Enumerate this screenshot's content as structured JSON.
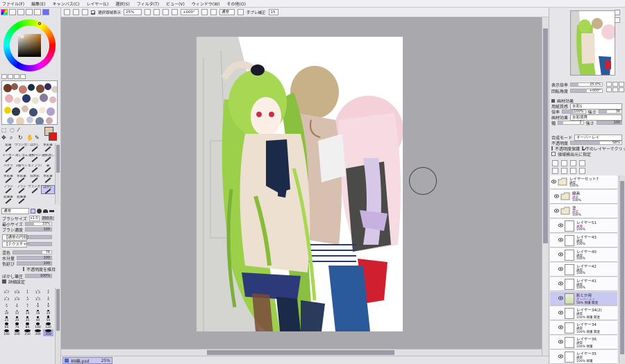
{
  "menu": [
    "ファイル(F)",
    "編集(E)",
    "キャンバス(C)",
    "レイヤー(L)",
    "選択(S)",
    "フィルタ(T)",
    "ビュー(V)",
    "ウィンドウ(W)",
    "その他(O)"
  ],
  "toolbar": {
    "selection_source_label": "選択領域表示",
    "zoom": "25%",
    "rotation": "+000°",
    "mode": "通常",
    "stabilizer_label": "手ブレ補正",
    "stabilizer_value": "15"
  },
  "tools": {
    "row1": [
      "鉛筆",
      "ウランガン",
      "ぼかし",
      "水彩筆"
    ],
    "row2": [
      "マーカー",
      "消しゴム",
      "選択ペン",
      "選択消し"
    ],
    "row3": [
      "バケツ",
      "2値ペン",
      "エアブラシ",
      "筆"
    ],
    "row4": [
      "水彩筆",
      "水彩筆",
      "旧水彩",
      "水彩筆"
    ],
    "row5": [
      "ブラシ",
      "ブラシ",
      "ウランガン",
      "ぼかし"
    ],
    "row6": [
      "鉛筆筆",
      "鉛筆筆"
    ]
  },
  "brush": {
    "mode": "通常",
    "size_label": "ブラシサイズ",
    "size_mult": "x1.0",
    "size_value": "350.0",
    "min_size_label": "最小サイズ",
    "min_size_value": "33%",
    "density_label": "ブラシ濃度",
    "density_value": "100",
    "shape_label": "【通常の円形】",
    "texture_label": "【テクスチャなし】",
    "blend_label": "混色",
    "blend_value": "76",
    "water_label": "水分量",
    "water_value": "100",
    "stretch_label": "色延び",
    "stretch_value": "100",
    "keep_opacity_label": "不透明度を維持",
    "blur_pressure_label": "ぼかし筆圧",
    "blur_pressure_value": "100%",
    "detail_label": "詳細設定",
    "sizes": [
      "0.7",
      "0.8",
      "1",
      "1.5",
      "2",
      "2.3",
      "2.6",
      "3",
      "3.5",
      "4",
      "5",
      "6",
      "7",
      "8",
      "9",
      "10",
      "12",
      "14",
      "16",
      "20",
      "25",
      "30",
      "35",
      "40",
      "50",
      "60",
      "70",
      "80",
      "100",
      "120",
      "160",
      "200",
      "250",
      "300",
      "350"
    ],
    "selected_size": "350"
  },
  "navigator": {
    "zoom_label": "表示倍率",
    "zoom_value": "25.0%",
    "angle_label": "回転角度",
    "angle_value": "+000°"
  },
  "paper": {
    "header": "画材効果",
    "texture_label": "用紙質感",
    "texture_value": "水彩1",
    "scale_label": "倍率",
    "scale_value": "100%",
    "strength_label": "強さ",
    "strength_value": "36",
    "effect_label": "画材効果",
    "effect_value": "水彩境界",
    "width_label": "幅",
    "width_value": "2",
    "intensity_label": "強さ",
    "intensity_value": "100"
  },
  "layer_opts": {
    "blend_label": "合成モード",
    "blend_value": "オーバーレイ",
    "opacity_label": "不透明度",
    "opacity_value": "58%",
    "protect_label": "不透明度保護",
    "clip_label": "下のレイヤーでクリッピング",
    "ref_label": "領域検出元に指定"
  },
  "layers": [
    {
      "name": "レイヤーセット7",
      "blend": "通常",
      "op": "100%",
      "kind": "set"
    },
    {
      "name": "線画",
      "blend": "通常",
      "op": "100%",
      "kind": "folder",
      "blendColor": "#a03090"
    },
    {
      "name": "塗",
      "blend": "通常",
      "op": "100%",
      "kind": "folder",
      "blendColor": "#a03090"
    },
    {
      "name": "レイヤー51",
      "blend": "乗算",
      "op": "100%",
      "kind": "layer",
      "blendColor": "#a03090"
    },
    {
      "name": "レイヤー43",
      "blend": "通常",
      "op": "100%",
      "kind": "layer"
    },
    {
      "name": "レイヤー40",
      "blend": "通常",
      "op": "100%",
      "kind": "layer"
    },
    {
      "name": "レイヤー42",
      "blend": "通常",
      "op": "100%",
      "kind": "layer"
    },
    {
      "name": "レイヤー41",
      "blend": "通常",
      "op": "100%",
      "kind": "layer"
    },
    {
      "name": "影とか用",
      "blend": "オーバーレイ",
      "op": "58% 保護 関連",
      "kind": "layer",
      "selected": true,
      "blendColor": "#a03090"
    },
    {
      "name": "レイヤー34(2)",
      "blend": "通常",
      "op": "100% 保護 関連",
      "kind": "layer"
    },
    {
      "name": "レイヤー34",
      "blend": "通常",
      "op": "100% 保護 関連",
      "kind": "layer"
    },
    {
      "name": "レイヤー36",
      "blend": "通常",
      "op": "100% 保護",
      "kind": "layer"
    },
    {
      "name": "レイヤー35",
      "blend": "通常",
      "op": "100% 保護",
      "kind": "layer"
    }
  ],
  "status": {
    "filename": "89編.psd",
    "zoom": "25%"
  },
  "colors": {
    "accent": "#a8a8e0",
    "selected_layer": "#c8c8f0",
    "foreground": "#d8cbb0",
    "background_color": "#e01818"
  }
}
